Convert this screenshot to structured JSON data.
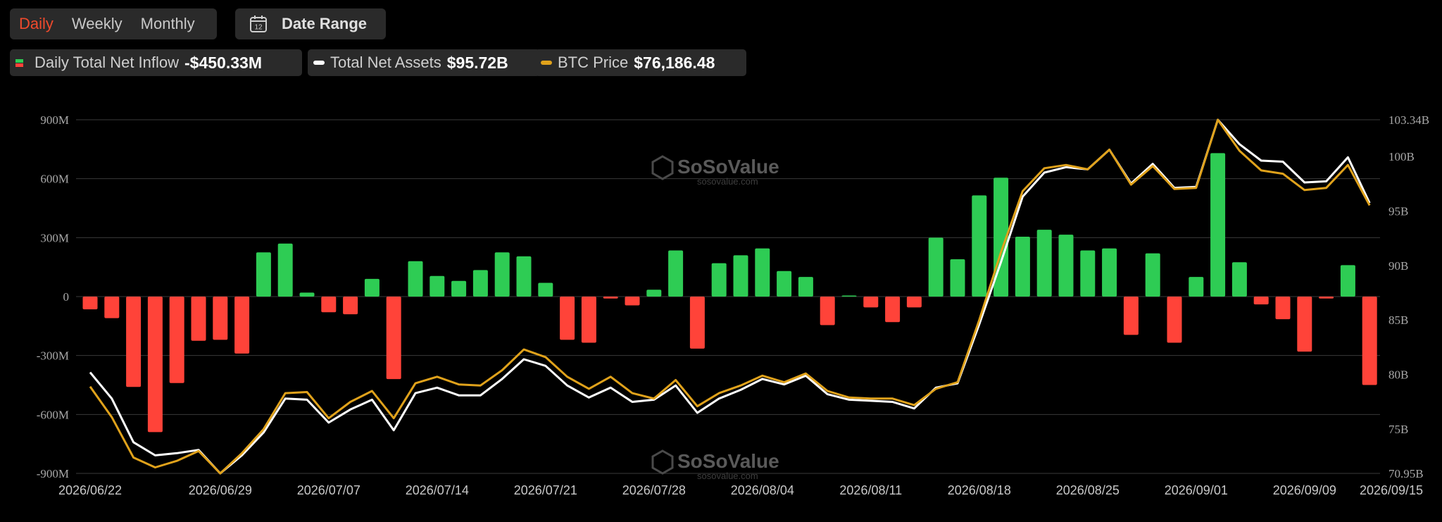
{
  "tabs": [
    {
      "label": "Daily",
      "active": true
    },
    {
      "label": "Weekly",
      "active": false
    },
    {
      "label": "Monthly",
      "active": false
    }
  ],
  "date_range": {
    "label": "Date Range",
    "icon": "calendar-icon",
    "icon_text": "12"
  },
  "legend": {
    "inflow": {
      "label": "Daily Total Net Inflow",
      "value": "-$450.33M"
    },
    "assets": {
      "label": "Total Net Assets",
      "value": "$95.72B",
      "color": "#ffffff"
    },
    "btc": {
      "label": "BTC Price",
      "value": "$76,186.48",
      "color": "#e0a21b"
    }
  },
  "watermark": {
    "brand": "SoSoValue",
    "url": "sosovalue.com"
  },
  "colors": {
    "positive": "#2ecc54",
    "negative": "#ff4339",
    "grid": "#3a3a3a",
    "background": "#000000"
  },
  "chart_data": {
    "type": "bar",
    "left_axis": {
      "ticks": [
        "900M",
        "600M",
        "300M",
        "0",
        "-300M",
        "-600M",
        "-900M"
      ],
      "ylim": [
        -900,
        900
      ],
      "unit": "M"
    },
    "right_axis": {
      "ticks": [
        "103.34B",
        "100B",
        "95B",
        "90B",
        "85B",
        "80B",
        "75B",
        "70.95B"
      ],
      "ylim": [
        70.95,
        103.34
      ],
      "unit": "B"
    },
    "x_labels": [
      "2026/06/22",
      "2026/06/29",
      "2026/07/07",
      "2026/07/14",
      "2026/07/21",
      "2026/07/28",
      "2026/08/04",
      "2026/08/11",
      "2026/08/18",
      "2026/08/25",
      "2026/09/01",
      "2026/09/09",
      "2026/09/15"
    ],
    "x_label_index": [
      0,
      6,
      11,
      16,
      21,
      26,
      31,
      36,
      41,
      46,
      51,
      56,
      60
    ],
    "series": [
      {
        "name": "Daily Total Net Inflow",
        "type": "bar",
        "values": [
          -65,
          -110,
          -460,
          -690,
          -440,
          -225,
          -220,
          -290,
          225,
          270,
          20,
          -80,
          -90,
          90,
          -420,
          180,
          105,
          80,
          135,
          225,
          205,
          70,
          -220,
          -235,
          -10,
          -45,
          35,
          235,
          -265,
          170,
          210,
          245,
          130,
          100,
          -145,
          5,
          -55,
          -130,
          -55,
          300,
          190,
          515,
          605,
          305,
          340,
          315,
          235,
          245,
          -195,
          220,
          -235,
          100,
          730,
          175,
          -40,
          -115,
          -280,
          -10,
          160,
          -450
        ]
      },
      {
        "name": "Total Net Assets",
        "type": "line",
        "values": [
          80.2,
          77.8,
          73.8,
          72.6,
          72.8,
          73.1,
          70.95,
          72.6,
          74.7,
          77.8,
          77.7,
          75.6,
          76.8,
          77.7,
          74.9,
          78.3,
          78.8,
          78.1,
          78.1,
          79.6,
          81.4,
          80.8,
          79.0,
          77.9,
          78.8,
          77.5,
          77.7,
          79.0,
          76.5,
          77.8,
          78.6,
          79.6,
          79.1,
          79.9,
          78.2,
          77.7,
          77.6,
          77.5,
          76.9,
          78.8,
          79.2,
          84.6,
          90.3,
          96.3,
          98.5,
          99.0,
          98.8,
          100.6,
          97.5,
          99.3,
          97.1,
          97.2,
          103.34,
          101.1,
          99.6,
          99.5,
          97.6,
          97.7,
          99.9,
          95.72
        ]
      },
      {
        "name": "BTC Price",
        "type": "line",
        "values": [
          78.9,
          76.1,
          72.4,
          71.5,
          72.1,
          73.0,
          70.95,
          72.8,
          75.0,
          78.3,
          78.4,
          76.0,
          77.5,
          78.5,
          76.0,
          79.2,
          79.8,
          79.1,
          79.0,
          80.4,
          82.3,
          81.6,
          79.8,
          78.7,
          79.8,
          78.3,
          77.8,
          79.5,
          77.1,
          78.3,
          79.0,
          79.9,
          79.3,
          80.1,
          78.5,
          77.9,
          77.8,
          77.8,
          77.2,
          78.7,
          79.3,
          85.0,
          91.2,
          96.8,
          98.9,
          99.2,
          98.8,
          100.6,
          97.4,
          99.1,
          97.0,
          97.1,
          103.34,
          100.5,
          98.7,
          98.4,
          96.9,
          97.1,
          99.2,
          95.5
        ]
      }
    ]
  }
}
